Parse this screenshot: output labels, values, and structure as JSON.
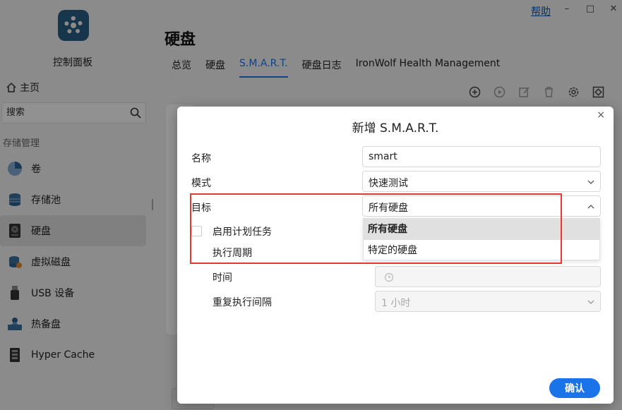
{
  "window": {
    "help_label": "帮助",
    "minimize": "–",
    "maximize": "□",
    "close": "✕"
  },
  "sidebar": {
    "app_title": "控制面板",
    "home_label": "主页",
    "search_placeholder": "搜索",
    "section_label": "存储管理",
    "items": [
      {
        "label": "卷",
        "icon": "pie-volume-icon"
      },
      {
        "label": "存储池",
        "icon": "storage-pool-icon"
      },
      {
        "label": "硬盘",
        "icon": "hard-disk-icon",
        "active": true
      },
      {
        "label": "虚拟磁盘",
        "icon": "virtual-disk-icon"
      },
      {
        "label": "USB 设备",
        "icon": "usb-icon"
      },
      {
        "label": "热备盘",
        "icon": "hot-spare-icon"
      },
      {
        "label": "Hyper Cache",
        "icon": "hyper-cache-icon"
      }
    ]
  },
  "main": {
    "title": "硬盘",
    "tabs": [
      "总览",
      "硬盘",
      "S.M.A.R.T.",
      "硬盘日志",
      "IronWolf Health Management"
    ],
    "active_tab": "S.M.A.R.T."
  },
  "dialog": {
    "title": "新增 S.M.A.R.T.",
    "close": "×",
    "name_label": "名称",
    "name_value": "smart",
    "mode_label": "模式",
    "mode_value": "快速测试",
    "target_label": "目标",
    "target_value": "所有硬盘",
    "target_options": [
      "所有硬盘",
      "特定的硬盘"
    ],
    "schedule_label": "启用计划任务",
    "period_label": "执行周期",
    "time_label": "时间",
    "repeat_label": "重复执行间隔",
    "repeat_value": "1 小时",
    "confirm_label": "确认"
  },
  "colors": {
    "accent": "#1a73e8",
    "highlight_box": "#e53935"
  }
}
